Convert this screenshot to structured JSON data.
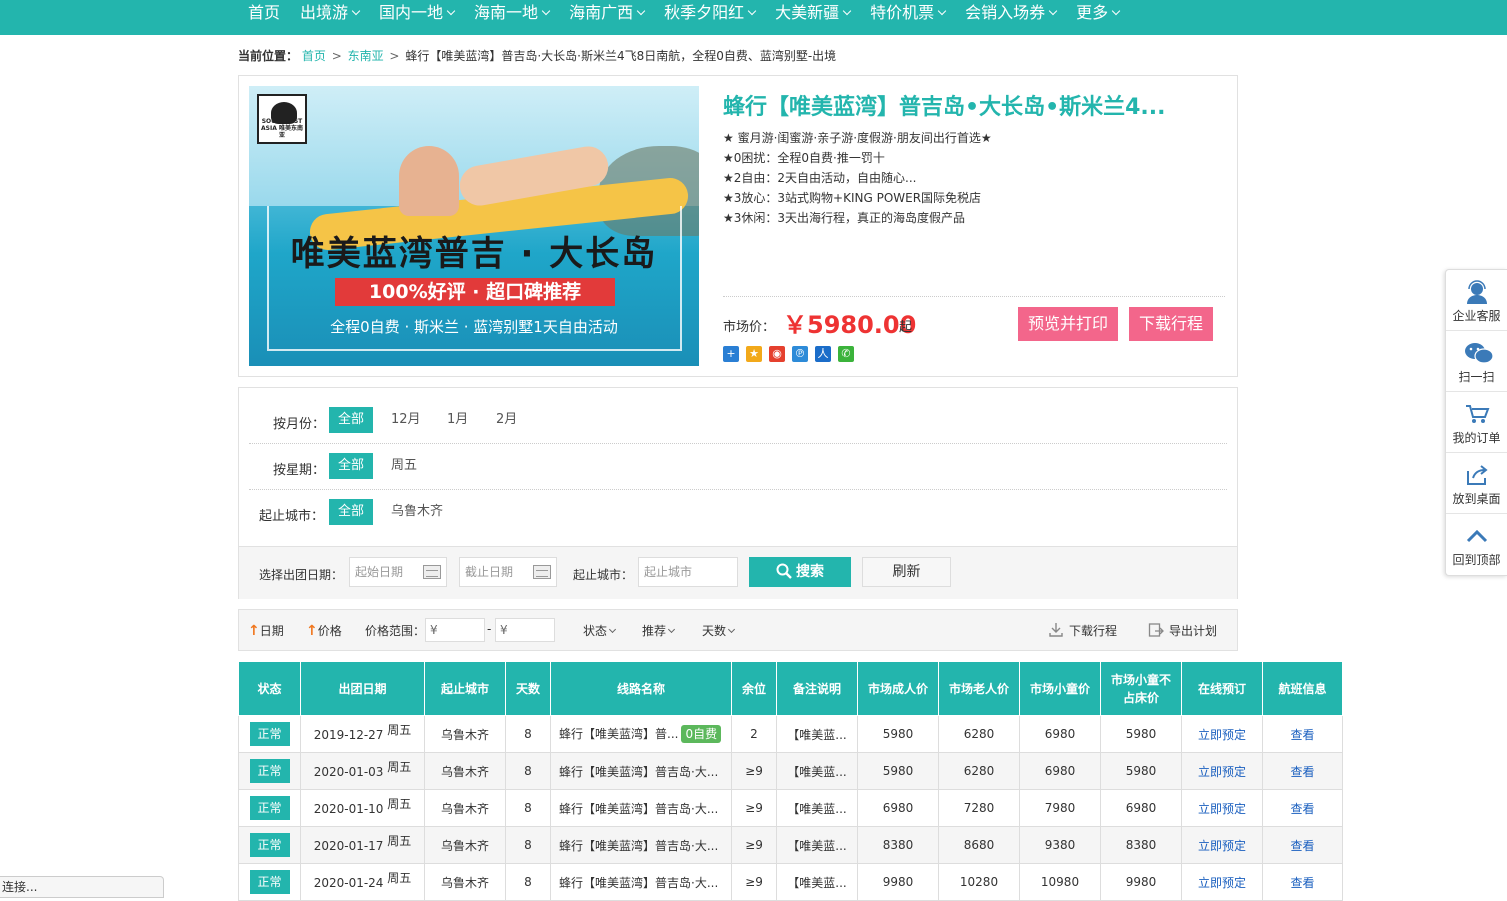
{
  "nav": {
    "items": [
      {
        "label": "首页",
        "dropdown": false
      },
      {
        "label": "出境游",
        "dropdown": true
      },
      {
        "label": "国内一地",
        "dropdown": true
      },
      {
        "label": "海南一地",
        "dropdown": true
      },
      {
        "label": "海南广西",
        "dropdown": true
      },
      {
        "label": "秋季夕阳红",
        "dropdown": true
      },
      {
        "label": "大美新疆",
        "dropdown": true
      },
      {
        "label": "特价机票",
        "dropdown": true
      },
      {
        "label": "会销入场券",
        "dropdown": true
      },
      {
        "label": "更多",
        "dropdown": true
      }
    ]
  },
  "breadcrumb": {
    "label": "当前位置：",
    "home": "首页",
    "sep": ">",
    "category": "东南亚",
    "current": "蜂行【唯美蓝湾】普吉岛·大长岛·斯米兰4飞8日南航，全程0自费、蓝湾别墅-出境"
  },
  "product": {
    "title": "蜂行【唯美蓝湾】普吉岛•大长岛•斯米兰4...",
    "banner": {
      "logo_text": "SOUTHEAST ASIA 唯美东南亚",
      "headline": "唯美蓝湾普吉 · 大长岛",
      "badge": "100%好评 · 超口碑推荐",
      "subline": "全程0自费 · 斯米兰 · 蓝湾别墅1天自由活动"
    },
    "features": [
      "★ 蜜月游·闺蜜游·亲子游·度假游·朋友间出行首选★",
      "★0困扰：全程0自费·推一罚十",
      "★2自由：2天自由活动，自由随心...",
      "★3放心：3站式购物+KING POWER国际免税店",
      "★3休闲：3天出海行程，真正的海岛度假产品"
    ],
    "price_label": "市场价：",
    "price": "￥5980.00",
    "price_suffix": "起",
    "btn_print": "预览并打印",
    "btn_download": "下载行程"
  },
  "filters": {
    "month": {
      "label": "按月份：",
      "options": [
        "全部",
        "12月",
        "1月",
        "2月"
      ]
    },
    "week": {
      "label": "按星期：",
      "options": [
        "全部",
        "周五"
      ]
    },
    "city": {
      "label": "起止城市：",
      "options": [
        "全部",
        "乌鲁木齐"
      ]
    },
    "search": {
      "date_label": "选择出团日期：",
      "start_placeholder": "起始日期",
      "end_placeholder": "截止日期",
      "city_label": "起止城市：",
      "city_placeholder": "起止城市",
      "search_btn": "搜索",
      "refresh_btn": "刷新"
    }
  },
  "sortbar": {
    "date": "日期",
    "price": "价格",
    "range_label": "价格范围：",
    "range_from": "¥",
    "range_dash": "-",
    "range_to": "¥",
    "status": "状态",
    "recommend": "推荐",
    "days": "天数",
    "download": "下载行程",
    "export": "导出计划"
  },
  "table": {
    "headers": [
      "状态",
      "出团日期",
      "起止城市",
      "天数",
      "线路名称",
      "余位",
      "备注说明",
      "市场成人价",
      "市场老人价",
      "市场小童价",
      "市场小童不占床价",
      "在线预订",
      "航班信息"
    ],
    "rows": [
      {
        "status": "正常",
        "date": "2019-12-27",
        "weekday": "周五",
        "city": "乌鲁木齐",
        "days": "8",
        "name": "蜂行【唯美蓝湾】普...",
        "tag": "0自费",
        "seats": "2",
        "note": "【唯美蓝...",
        "adult": "5980",
        "senior": "6280",
        "child": "6980",
        "child_nobed": "5980",
        "book": "立即预定",
        "flight": "查看"
      },
      {
        "status": "正常",
        "date": "2020-01-03",
        "weekday": "周五",
        "city": "乌鲁木齐",
        "days": "8",
        "name": "蜂行【唯美蓝湾】普吉岛·大...",
        "tag": "",
        "seats": "≥9",
        "note": "【唯美蓝...",
        "adult": "5980",
        "senior": "6280",
        "child": "6980",
        "child_nobed": "5980",
        "book": "立即预定",
        "flight": "查看"
      },
      {
        "status": "正常",
        "date": "2020-01-10",
        "weekday": "周五",
        "city": "乌鲁木齐",
        "days": "8",
        "name": "蜂行【唯美蓝湾】普吉岛·大...",
        "tag": "",
        "seats": "≥9",
        "note": "【唯美蓝...",
        "adult": "6980",
        "senior": "7280",
        "child": "7980",
        "child_nobed": "6980",
        "book": "立即预定",
        "flight": "查看"
      },
      {
        "status": "正常",
        "date": "2020-01-17",
        "weekday": "周五",
        "city": "乌鲁木齐",
        "days": "8",
        "name": "蜂行【唯美蓝湾】普吉岛·大...",
        "tag": "",
        "seats": "≥9",
        "note": "【唯美蓝...",
        "adult": "8380",
        "senior": "8680",
        "child": "9380",
        "child_nobed": "8380",
        "book": "立即预定",
        "flight": "查看"
      },
      {
        "status": "正常",
        "date": "2020-01-24",
        "weekday": "周五",
        "city": "乌鲁木齐",
        "days": "8",
        "name": "蜂行【唯美蓝湾】普吉岛·大...",
        "tag": "",
        "seats": "≥9",
        "note": "【唯美蓝...",
        "adult": "9980",
        "senior": "10280",
        "child": "10980",
        "child_nobed": "9980",
        "book": "立即预定",
        "flight": "查看"
      }
    ]
  },
  "sidebar": {
    "items": [
      {
        "label": "企业客服",
        "icon": "customer-service-icon"
      },
      {
        "label": "扫一扫",
        "icon": "wechat-icon"
      },
      {
        "label": "我的订单",
        "icon": "cart-icon"
      },
      {
        "label": "放到桌面",
        "icon": "share-desktop-icon"
      },
      {
        "label": "回到顶部",
        "icon": "chevron-up-icon"
      }
    ]
  },
  "statusbar": {
    "text": "连接..."
  },
  "colors": {
    "accent": "#23b5ad",
    "pink": "#f3668b",
    "price": "#ee3333",
    "link": "#1a5fbf"
  }
}
